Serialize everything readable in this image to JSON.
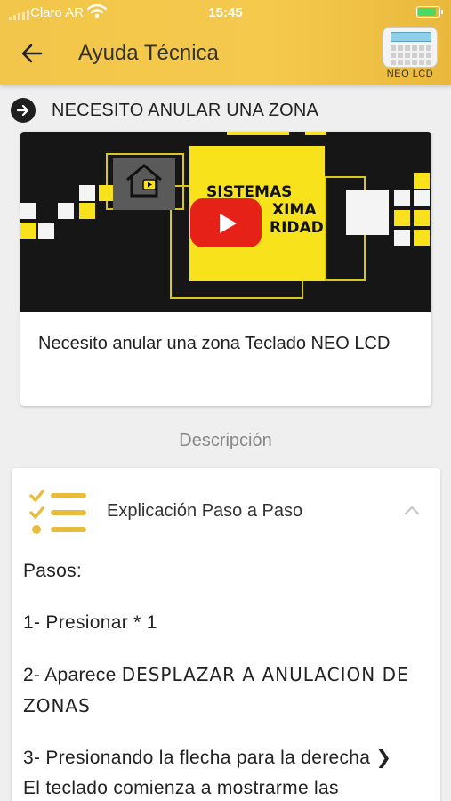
{
  "status_bar": {
    "carrier": "Claro AR",
    "time": "15:45"
  },
  "header": {
    "title": "Ayuda Técnica",
    "device_label": "NEO LCD",
    "back_icon": "arrow-left-icon",
    "background_color": "#f2c64a"
  },
  "section": {
    "icon": "arrow-right-circle-icon",
    "title": "NECESITO ANULAR UNA ZONA"
  },
  "video": {
    "thumbnail_text": [
      "SISTEMAS",
      "XIMA",
      "RIDAD"
    ],
    "caption": "Necesito anular una zona Teclado NEO LCD",
    "play_icon": "youtube-play-icon",
    "accent_color": "#f7e21b"
  },
  "description": {
    "label": "Descripción"
  },
  "steps": {
    "icon": "checklist-icon",
    "title": "Explicación Paso a Paso",
    "collapse_icon": "chevron-up-icon",
    "heading": "Pasos:",
    "step1": "1- Presionar * 1",
    "step2_prefix": "2- Aparece ",
    "step2_emph": "DESPLAZAR A ANULACION DE ZONAS",
    "step3_text": "3- Presionando la flecha para la derecha ",
    "step3_symbol": "❯",
    "step3_cont": "El teclado comienza a mostrarme las"
  }
}
